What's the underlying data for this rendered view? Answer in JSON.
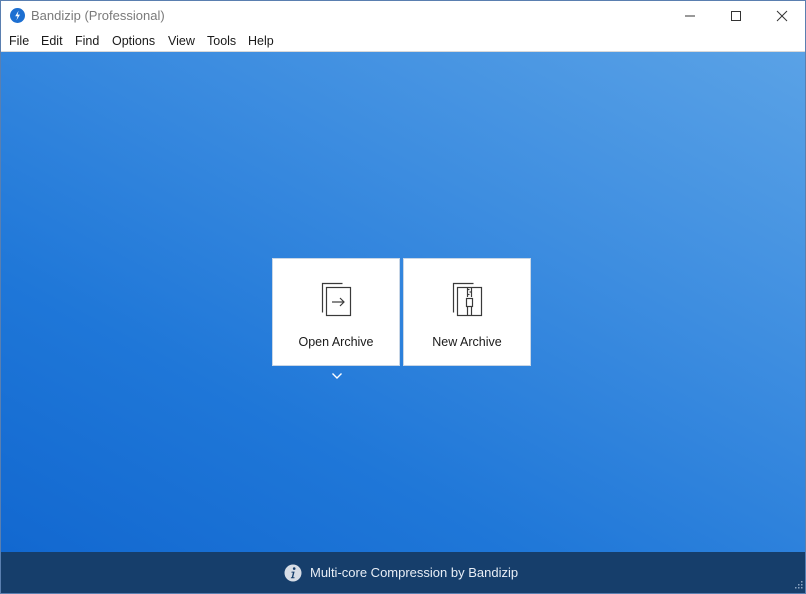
{
  "window": {
    "title": "Bandizip (Professional)"
  },
  "menu": {
    "items": [
      "File",
      "Edit",
      "Find",
      "Options",
      "View",
      "Tools",
      "Help"
    ]
  },
  "actions": {
    "open_archive": "Open Archive",
    "new_archive": "New Archive"
  },
  "status": {
    "text": "Multi-core Compression by Bandizip"
  },
  "icons": {
    "app": "bandizip-logo-icon",
    "open": "open-archive-icon",
    "new": "new-archive-icon",
    "dropdown": "chevron-down-icon",
    "info": "info-icon"
  },
  "colors": {
    "accent": "#1d6fd1",
    "background_light": "#5aa2e6",
    "background_dark": "#1268d0",
    "statusbar": "#163e6b"
  }
}
